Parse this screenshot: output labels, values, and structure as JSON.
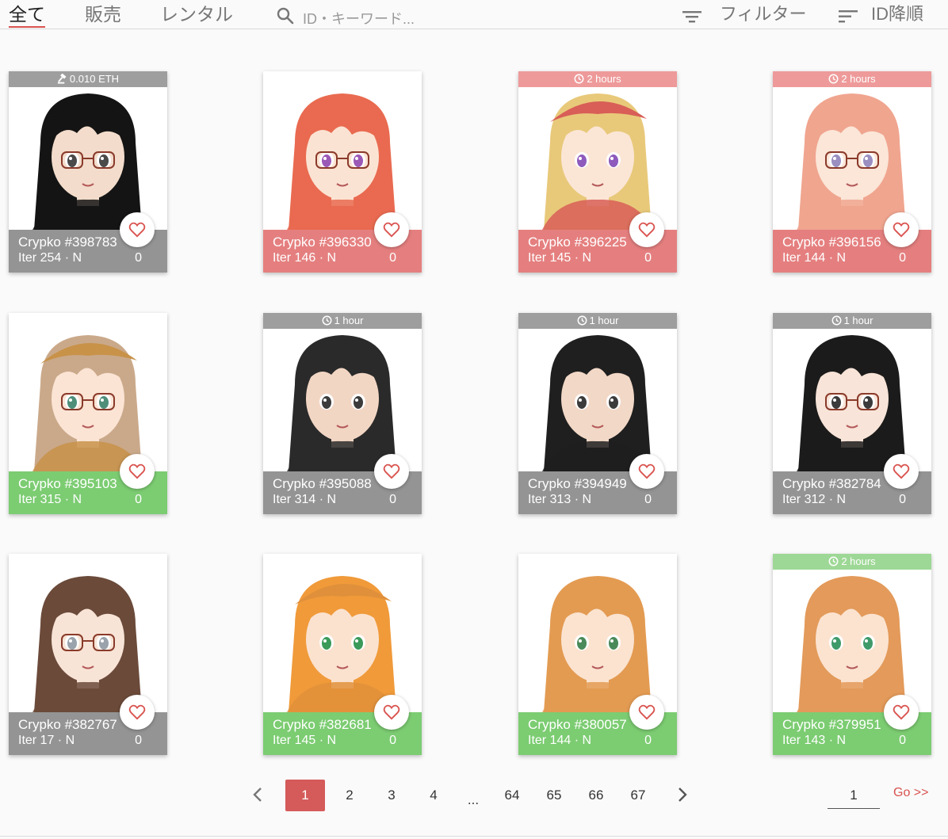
{
  "tabs": [
    {
      "label": "全て",
      "active": true
    },
    {
      "label": "販売",
      "active": false
    },
    {
      "label": "レンタル",
      "active": false
    }
  ],
  "search": {
    "placeholder": "ID・キーワード..."
  },
  "toolbar": {
    "filter_label": "フィルター",
    "sort_label": "ID降順"
  },
  "colors": {
    "accent": "#d9534f",
    "grey_footer": "#949494",
    "red_footer": "#e57f7f",
    "green_footer": "#7ccc72",
    "grey_banner": "#9e9e9e",
    "red_banner": "#ee9a9a",
    "green_banner": "#9ed896"
  },
  "cards": [
    {
      "name": "Crypko #398783",
      "meta": "Iter 254 · N",
      "likes": "0",
      "banner": "0.010 ETH",
      "banner_icon": "gavel-icon",
      "status": "grey",
      "hair": "#141414",
      "skin": "#f3dccb",
      "eyes": "#4a4a4a",
      "glasses": true,
      "hat": ""
    },
    {
      "name": "Crypko #396330",
      "meta": "Iter 146 · N",
      "likes": "0",
      "banner": "",
      "banner_icon": "",
      "status": "red",
      "hair": "#e96a50",
      "skin": "#fbe3d3",
      "eyes": "#9b59b6",
      "glasses": true,
      "hat": ""
    },
    {
      "name": "Crypko #396225",
      "meta": "Iter 145 · N",
      "likes": "0",
      "banner": "2 hours",
      "banner_icon": "clock-icon",
      "status": "red",
      "hair": "#e8c97a",
      "skin": "#fbe6d6",
      "eyes": "#8e5bbd",
      "glasses": false,
      "hat": "#d85e57"
    },
    {
      "name": "Crypko #396156",
      "meta": "Iter 144 · N",
      "likes": "0",
      "banner": "2 hours",
      "banner_icon": "clock-icon",
      "status": "red",
      "hair": "#f0a58f",
      "skin": "#fbe6d8",
      "eyes": "#9a8fc0",
      "glasses": true,
      "hat": ""
    },
    {
      "name": "Crypko #395103",
      "meta": "Iter 315 · N",
      "likes": "0",
      "banner": "",
      "banner_icon": "",
      "status": "green",
      "hair": "#caa98a",
      "skin": "#fbe4d4",
      "eyes": "#4f8f7a",
      "glasses": true,
      "hat": "#c89249"
    },
    {
      "name": "Crypko #395088",
      "meta": "Iter 314 · N",
      "likes": "0",
      "banner": "1 hour",
      "banner_icon": "clock-icon",
      "status": "grey",
      "hair": "#2a2a2a",
      "skin": "#f2d6c4",
      "eyes": "#3b3b3b",
      "glasses": false,
      "hat": ""
    },
    {
      "name": "Crypko #394949",
      "meta": "Iter 313 · N",
      "likes": "0",
      "banner": "1 hour",
      "banner_icon": "clock-icon",
      "status": "grey",
      "hair": "#1f1f1f",
      "skin": "#f2d8c7",
      "eyes": "#3b3b3b",
      "glasses": false,
      "hat": ""
    },
    {
      "name": "Crypko #382784",
      "meta": "Iter 312 · N",
      "likes": "0",
      "banner": "1 hour",
      "banner_icon": "clock-icon",
      "status": "grey",
      "hair": "#1b1b1b",
      "skin": "#f8e4d8",
      "eyes": "#3b3b3b",
      "glasses": true,
      "hat": ""
    },
    {
      "name": "Crypko #382767",
      "meta": "Iter 17 · N",
      "likes": "0",
      "banner": "",
      "banner_icon": "",
      "status": "grey",
      "hair": "#6b4a3a",
      "skin": "#f8e4d6",
      "eyes": "#9aa3ab",
      "glasses": true,
      "hat": ""
    },
    {
      "name": "Crypko #382681",
      "meta": "Iter 145 · N",
      "likes": "0",
      "banner": "",
      "banner_icon": "",
      "status": "green",
      "hair": "#f09a3a",
      "skin": "#fbe2cf",
      "eyes": "#3a9a5a",
      "glasses": false,
      "hat": "#e0903b"
    },
    {
      "name": "Crypko #380057",
      "meta": "Iter 144 · N",
      "likes": "0",
      "banner": "",
      "banner_icon": "",
      "status": "green",
      "hair": "#e39b52",
      "skin": "#fbe3d0",
      "eyes": "#4a8a5a",
      "glasses": false,
      "hat": ""
    },
    {
      "name": "Crypko #379951",
      "meta": "Iter 143 · N",
      "likes": "0",
      "banner": "2 hours",
      "banner_icon": "clock-icon",
      "status": "green",
      "hair": "#e39a5a",
      "skin": "#fbe3d0",
      "eyes": "#3f9a6a",
      "glasses": false,
      "hat": ""
    }
  ],
  "pagination": {
    "prev_icon": "chevron-left-icon",
    "next_icon": "chevron-right-icon",
    "pages": [
      "1",
      "2",
      "3",
      "4",
      "...",
      "64",
      "65",
      "66",
      "67"
    ],
    "current": "1",
    "jump_value": "1",
    "go_label": "Go >>"
  }
}
